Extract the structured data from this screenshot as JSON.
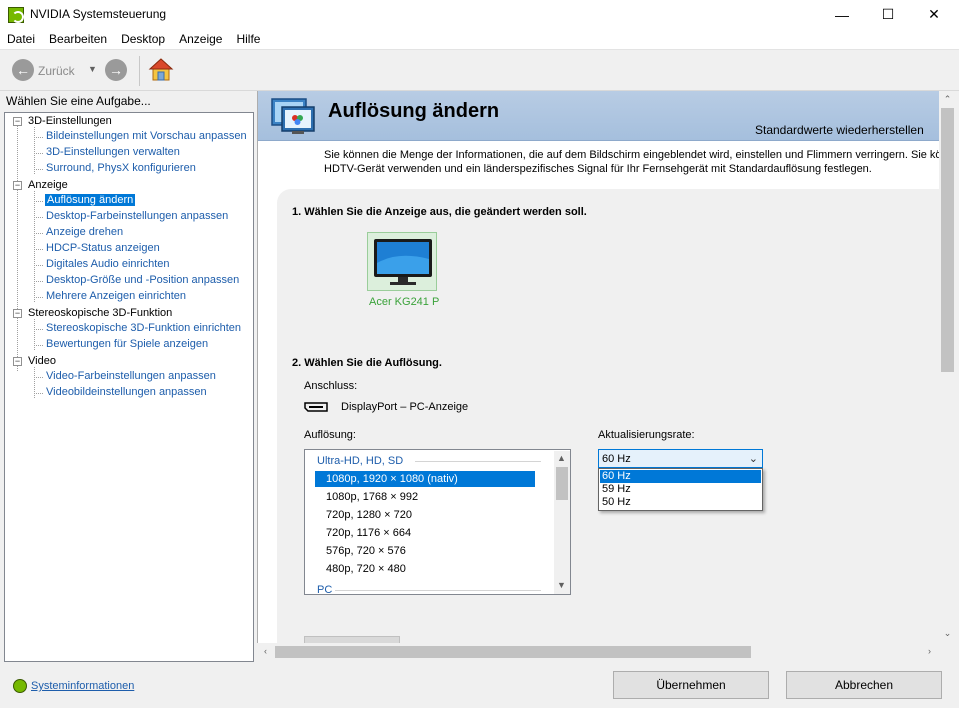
{
  "window": {
    "title": "NVIDIA Systemsteuerung",
    "minimize": "—",
    "maximize": "☐",
    "close": "✕"
  },
  "menu": [
    "Datei",
    "Bearbeiten",
    "Desktop",
    "Anzeige",
    "Hilfe"
  ],
  "toolbar": {
    "back_label": "Zurück"
  },
  "sidebar": {
    "heading": "Wählen Sie eine Aufgabe...",
    "categories": [
      {
        "label": "3D-Einstellungen",
        "items": [
          "Bildeinstellungen mit Vorschau anpassen",
          "3D-Einstellungen verwalten",
          "Surround, PhysX konfigurieren"
        ]
      },
      {
        "label": "Anzeige",
        "items": [
          "Auflösung ändern",
          "Desktop-Farbeinstellungen anpassen",
          "Anzeige drehen",
          "HDCP-Status anzeigen",
          "Digitales Audio einrichten",
          "Desktop-Größe und -Position anpassen",
          "Mehrere Anzeigen einrichten"
        ]
      },
      {
        "label": "Stereoskopische 3D-Funktion",
        "items": [
          "Stereoskopische 3D-Funktion einrichten",
          "Bewertungen für Spiele anzeigen"
        ]
      },
      {
        "label": "Video",
        "items": [
          "Video-Farbeinstellungen anpassen",
          "Videobildeinstellungen anpassen"
        ]
      }
    ],
    "selected": "Auflösung ändern"
  },
  "content": {
    "title": "Auflösung ändern",
    "restore_defaults": "Standardwerte wiederherstellen",
    "description_line1": "Sie können die Menge der Informationen, die auf dem Bildschirm eingeblendet wird, einstellen und Flimmern verringern. Sie können",
    "description_line2": "HDTV-Gerät verwenden und ein länderspezifisches Signal für Ihr Fernsehgerät mit Standardauflösung festlegen.",
    "step1": "1. Wählen Sie die Anzeige aus, die geändert werden soll.",
    "monitor_name": "Acer KG241 P",
    "step2": "2. Wählen Sie die Auflösung.",
    "connection_label": "Anschluss:",
    "connection_value": "DisplayPort – PC-Anzeige",
    "resolution_label": "Auflösung:",
    "refresh_label": "Aktualisierungsrate:",
    "resolution_group": "Ultra-HD, HD, SD",
    "resolutions": [
      "1080p, 1920 × 1080 (nativ)",
      "1080p, 1768 × 992",
      "720p, 1280 × 720",
      "720p, 1176 × 664",
      "576p, 720 × 576",
      "480p, 720 × 480"
    ],
    "next_group": "PC",
    "refresh_selected": "60 Hz",
    "refresh_options": [
      "60 Hz",
      "59 Hz",
      "50 Hz"
    ]
  },
  "footer": {
    "sysinfo": "Systeminformationen",
    "apply": "Übernehmen",
    "cancel": "Abbrechen"
  },
  "colors": {
    "accent": "#0078d7",
    "nvidia_green": "#76b900",
    "link": "#1d5dab",
    "header_band": "#b8cce4"
  }
}
